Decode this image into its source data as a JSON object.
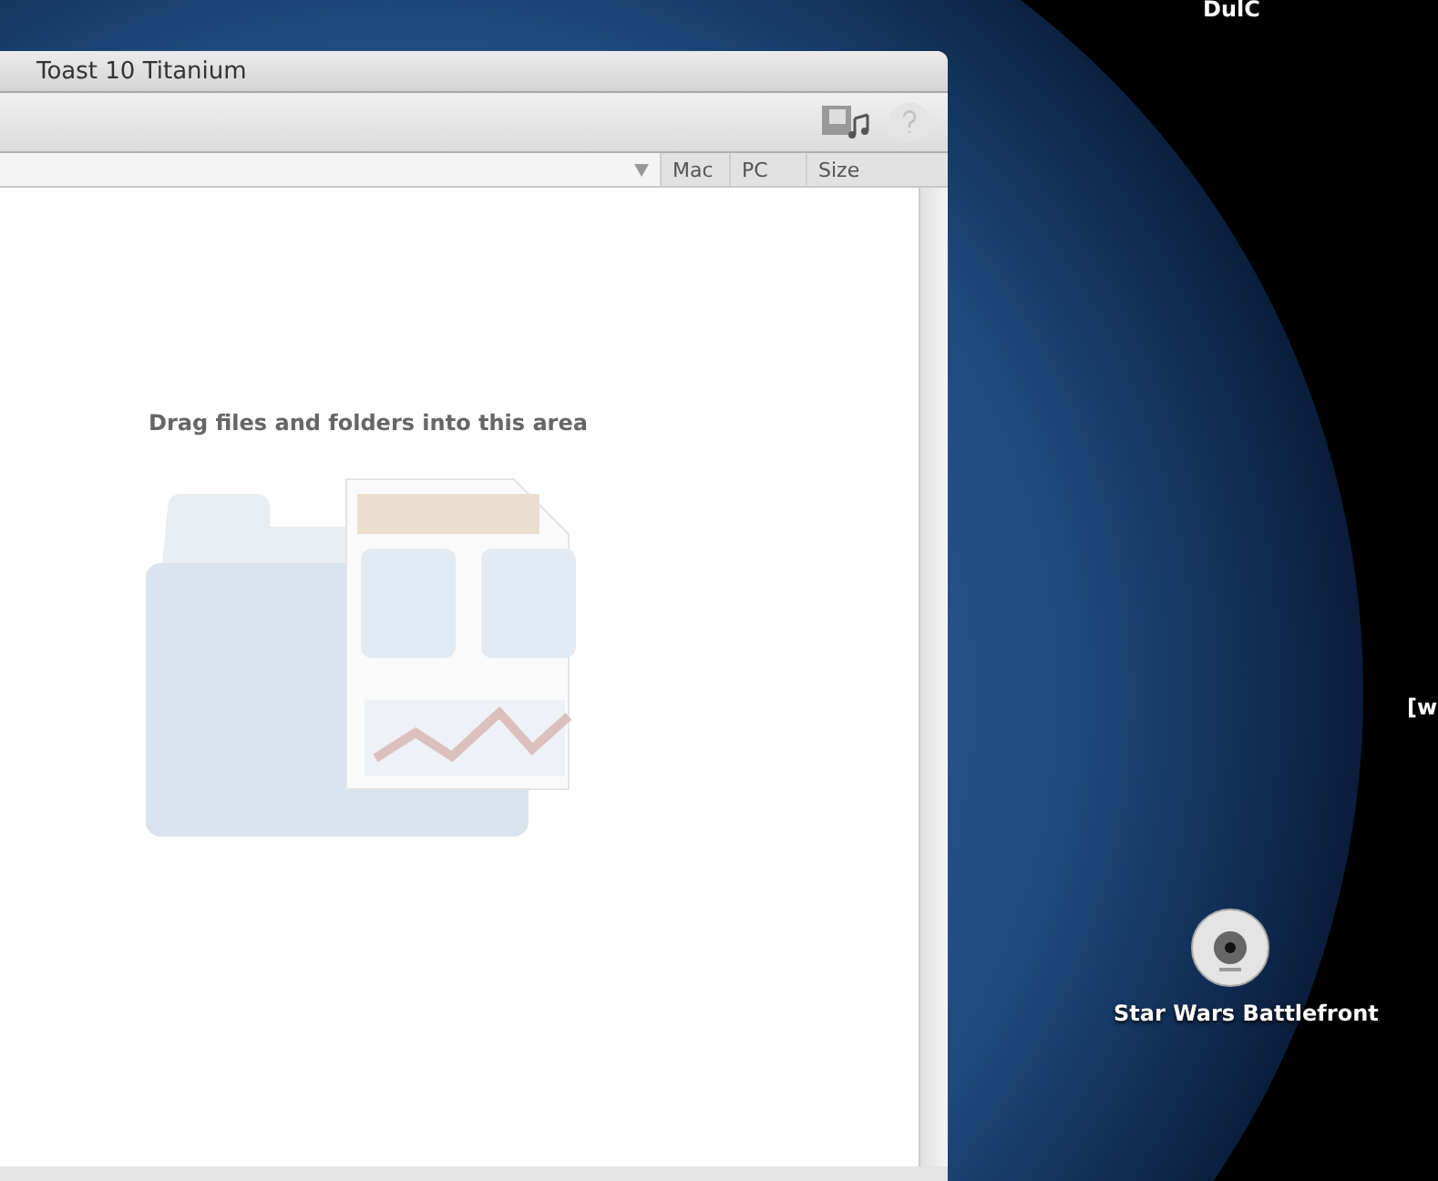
{
  "window": {
    "title": "Toast 10 Titanium"
  },
  "columns": [
    {
      "label": "Mac"
    },
    {
      "label": "PC"
    },
    {
      "label": "Size"
    }
  ],
  "drop_area": {
    "hint": "Drag files and folders into this area"
  },
  "desktop_items": [
    {
      "kind": "label",
      "label": "DulC"
    },
    {
      "kind": "label",
      "label": "[w"
    },
    {
      "kind": "disc",
      "label": "Star Wars Battlefront"
    }
  ]
}
